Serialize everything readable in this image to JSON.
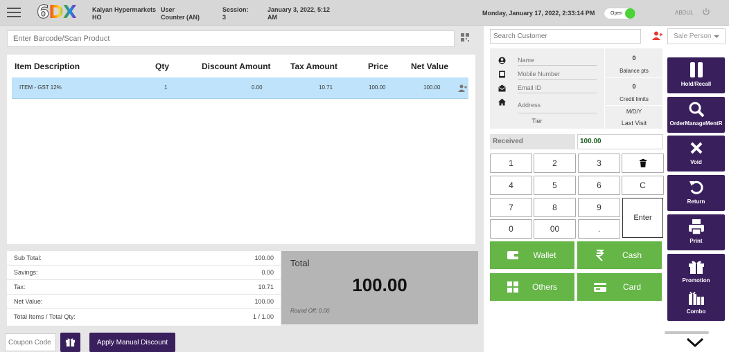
{
  "header": {
    "logo": {
      "six": "6",
      "dx": "DX"
    },
    "store_name": "Kalyan Hypermarkets",
    "store_code": "HO",
    "user_label": "User",
    "user_value": "Counter (AN)",
    "session_label": "Session:",
    "session_value": "3",
    "session_date_line1": "January 3, 2022, 5:12",
    "session_date_line2": "AM",
    "current_datetime": "Monday, January 17, 2022, 2:33:14 PM",
    "status_toggle": "Open",
    "username": "ABDUL"
  },
  "barcode": {
    "placeholder": "Enter Barcode/Scan Product"
  },
  "items_table": {
    "columns": [
      "Item Description",
      "Qty",
      "Discount Amount",
      "Tax Amount",
      "Price",
      "Net Value"
    ],
    "rows": [
      {
        "description": "ITEM - GST 12%",
        "qty": "1",
        "discount": "0.00",
        "tax": "10.71",
        "price": "100.00",
        "net": "100.00"
      }
    ]
  },
  "summary": {
    "sub_total_label": "Sub Total:",
    "sub_total": "100.00",
    "savings_label": "Savings:",
    "savings": "0.00",
    "tax_label": "Tax:",
    "tax": "10.71",
    "net_value_label": "Net Value:",
    "net_value": "100.00",
    "items_qty_label": "Total Items / Total Qty:",
    "items_qty": "1 / 1.00"
  },
  "total": {
    "label": "Total",
    "amount": "100.00",
    "round_off": "Round Off: 0.00"
  },
  "coupon": {
    "placeholder": "Coupon Code"
  },
  "manual_discount_label": "Apply Manual Discount",
  "customer": {
    "search_placeholder": "Search Customer",
    "sale_person": "Sale Person",
    "name_placeholder": "Name",
    "mobile_placeholder": "Mobile Number",
    "email_placeholder": "Email ID",
    "address_placeholder": "Address",
    "balance_value": "0",
    "balance_label": "Balance pts",
    "credit_value": "0",
    "credit_label": "Credit limits",
    "last_visit_value": "M/D/Y",
    "last_visit_label": "Last Visit",
    "tier_label": "Tier"
  },
  "received": {
    "label": "Received",
    "value": "100.00"
  },
  "keypad": {
    "k1": "1",
    "k2": "2",
    "k3": "3",
    "k4": "4",
    "k5": "5",
    "k6": "6",
    "kc": "C",
    "k7": "7",
    "k8": "8",
    "k9": "9",
    "k0": "0",
    "k00": "00",
    "kdot": ".",
    "enter": "Enter"
  },
  "payments": {
    "wallet": "Wallet",
    "cash": "Cash",
    "others": "Others",
    "card": "Card"
  },
  "actions": {
    "hold": "Hold/Recall",
    "order": "OrderManageMentR",
    "void": "Void",
    "return": "Return",
    "print": "Print",
    "promotion": "Promotion",
    "combo": "Combo"
  },
  "colors": {
    "accent": "#3a1f5d",
    "pay_green": "#65b547",
    "row_highlight": "#bfe3fa",
    "status_green": "#4cd137"
  }
}
